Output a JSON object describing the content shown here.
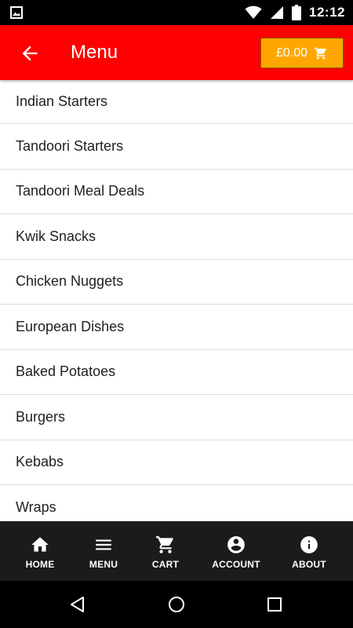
{
  "status_bar": {
    "time": "12:12",
    "icons": [
      "image-icon",
      "wifi-icon",
      "cell-signal-icon",
      "battery-icon"
    ]
  },
  "app_bar": {
    "title": "Menu",
    "cart_total": "£0.00",
    "accent_color": "#fe0000",
    "cart_button_color": "#ffa700"
  },
  "menu": {
    "items": [
      {
        "label": "Indian Starters"
      },
      {
        "label": "Tandoori Starters"
      },
      {
        "label": "Tandoori Meal Deals"
      },
      {
        "label": "Kwik Snacks"
      },
      {
        "label": "Chicken Nuggets"
      },
      {
        "label": "European Dishes"
      },
      {
        "label": "Baked Potatoes"
      },
      {
        "label": "Burgers"
      },
      {
        "label": "Kebabs"
      },
      {
        "label": "Wraps"
      }
    ]
  },
  "bottom_nav": {
    "items": [
      {
        "label": "HOME",
        "icon": "home-icon"
      },
      {
        "label": "MENU",
        "icon": "menu-icon"
      },
      {
        "label": "CART",
        "icon": "cart-icon"
      },
      {
        "label": "ACCOUNT",
        "icon": "account-icon"
      },
      {
        "label": "ABOUT",
        "icon": "info-icon"
      }
    ]
  },
  "system_nav": {
    "buttons": [
      "back-triangle-icon",
      "home-circle-icon",
      "recents-square-icon"
    ]
  }
}
